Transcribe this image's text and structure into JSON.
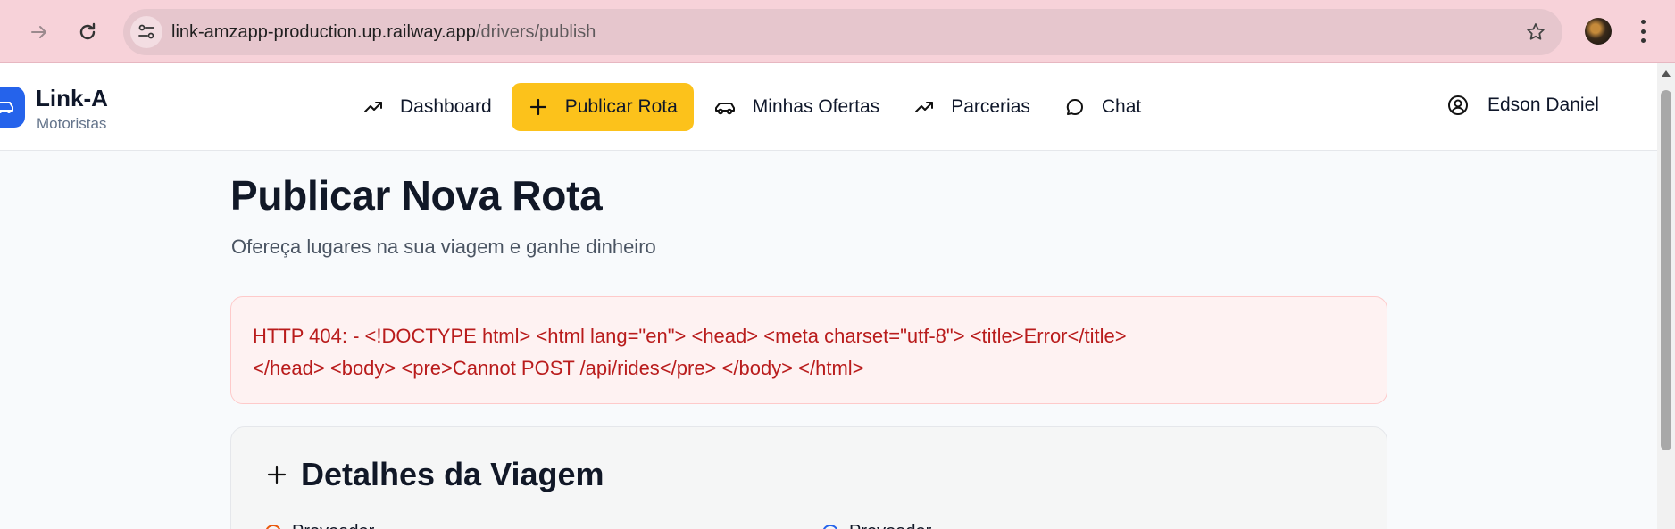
{
  "browser": {
    "url_host": "link-amzapp-production.up.railway.app",
    "url_path": "/drivers/publish"
  },
  "brand": {
    "name": "Link-A",
    "subtitle": "Motoristas"
  },
  "nav": {
    "items": [
      {
        "label": "Dashboard",
        "icon": "trending-up-icon"
      },
      {
        "label": "Publicar Rota",
        "icon": "plus-icon",
        "active": true
      },
      {
        "label": "Minhas Ofertas",
        "icon": "car-icon"
      },
      {
        "label": "Parcerias",
        "icon": "trending-up-icon"
      },
      {
        "label": "Chat",
        "icon": "chat-bubble-icon"
      }
    ]
  },
  "user": {
    "name": "Edson Daniel",
    "icon": "user-circle-icon"
  },
  "page": {
    "title": "Publicar Nova Rota",
    "subtitle": "Ofereça lugares na sua viagem e ganhe dinheiro"
  },
  "error": {
    "line1": "HTTP 404: - <!DOCTYPE html> <html lang=\"en\"> <head> <meta charset=\"utf-8\"> <title>Error</title>",
    "line2": "</head> <body> <pre>Cannot POST /api/rides</pre> </body> </html>"
  },
  "form": {
    "section_title": "Detalhes da Viagem",
    "origin_label": "Provoador",
    "destination_label": "Provoador"
  },
  "colors": {
    "accent": "#fcc21b",
    "brand": "#2563eb",
    "error_text": "#b91c1c",
    "error_bg": "#fef2f2",
    "chrome_bg": "#f7d2d9"
  }
}
